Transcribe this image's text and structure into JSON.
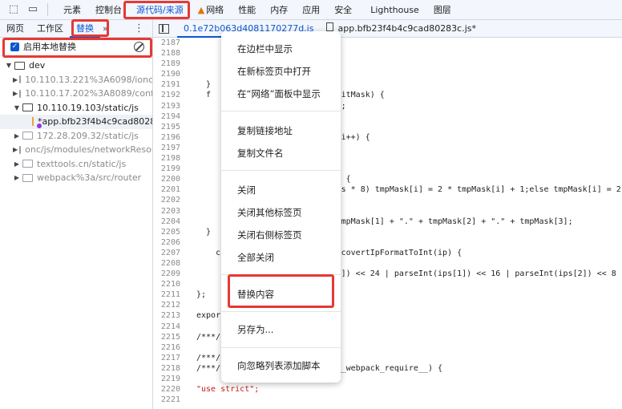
{
  "toolbar": {
    "inspect_icon": "element-picker-icon",
    "device_icon": "device-toggle-icon",
    "tabs": [
      "元素",
      "控制台",
      "源代码/来源",
      "网络",
      "性能",
      "内存",
      "应用",
      "安全",
      "Lighthouse",
      "图层"
    ],
    "active_tab": "源代码/来源",
    "network_warning_icon": "warning-icon"
  },
  "left_panel": {
    "subtabs": [
      "网页",
      "工作区",
      "替换"
    ],
    "active_subtab": "替换",
    "more_label": "»",
    "menu_icon": "kebab-menu-icon",
    "enable_overrides_label": "启用本地替换",
    "enable_overrides_checked": true,
    "tree": [
      {
        "label": "dev",
        "type": "folder",
        "expanded": true,
        "level": 0
      },
      {
        "label": "10.110.13.221%3A6098/ionc",
        "type": "folder",
        "expanded": false,
        "level": 1,
        "grey": true
      },
      {
        "label": "10.110.17.202%3A8089/config",
        "type": "folder",
        "expanded": false,
        "level": 1,
        "grey": true
      },
      {
        "label": "10.110.19.103/static/js",
        "type": "folder",
        "expanded": true,
        "level": 1
      },
      {
        "label": "*app.bfb23f4b4c9cad80283",
        "type": "file",
        "level": 2,
        "selected": true
      },
      {
        "label": "172.28.209.32/static/js",
        "type": "folder",
        "expanded": false,
        "level": 1,
        "grey": true
      },
      {
        "label": "onc/js/modules/networkResou",
        "type": "folder",
        "expanded": false,
        "level": 1,
        "grey": true
      },
      {
        "label": "texttools.cn/static/js",
        "type": "folder",
        "expanded": false,
        "level": 1,
        "grey": true
      },
      {
        "label": "webpack%3a/src/router",
        "type": "folder",
        "expanded": false,
        "level": 1,
        "grey": true
      }
    ]
  },
  "editor": {
    "tabs": [
      "0.1e72b063d4081170277d.js",
      "app.bfb23f4b4c9cad80283c.js*"
    ],
    "active_tab": "0.1e72b063d4081170277d.js",
    "lines": [
      {
        "n": "2187",
        "t": ""
      },
      {
        "n": "2188",
        "t": ""
      },
      {
        "n": "2189",
        "t": ""
      },
      {
        "n": "2190",
        "t": ""
      },
      {
        "n": "2191",
        "t": "  }"
      },
      {
        "n": "2192",
        "t": "  f                     Mask(bitMask) {"
      },
      {
        "n": "2193",
        "t": "                        urn \"\";"
      },
      {
        "n": "2194",
        "t": "                        0, 0];"
      },
      {
        "n": "2195",
        "t": "                        8;"
      },
      {
        "n": "2196",
        "t": "                        imes; i++) {"
      },
      {
        "n": "2197",
        "t": ""
      },
      {
        "n": "2198",
        "t": ""
      },
      {
        "n": "2199",
        "t": ""
      },
      {
        "n": "2200",
        "t": "                        ; j++) {"
      },
      {
        "n": "2201",
        "t": "                        - times * 8) tmpMask[i] = 2 * tmpMask[i] + 1;else tmpMask[i] = 2"
      },
      {
        "n": "2202",
        "t": ""
      },
      {
        "n": "2203",
        "t": ""
      },
      {
        "n": "2204",
        "t": "                        .\" + tmpMask[1] + \".\" + tmpMask[2] + \".\" + tmpMask[3];"
      },
      {
        "n": "2205",
        "t": "  }"
      },
      {
        "n": "2206",
        "t": ""
      },
      {
        "n": "2207",
        "t": "    c                   ction covertIpFormatToInt(ip) {"
      },
      {
        "n": "2208",
        "t": "                        ');"
      },
      {
        "n": "2209",
        "t": "                        (ips[0]) << 24 | parseInt(ips[1]) << 16 | parseInt(ips[2]) << 8"
      },
      {
        "n": "2210",
        "t": ""
      },
      {
        "n": "2211",
        "t": "};"
      },
      {
        "n": "2212",
        "t": ""
      },
      {
        "n": "2213",
        "t": "expor                   ules;"
      },
      {
        "n": "2214",
        "t": ""
      },
      {
        "n": "2215",
        "t": "/***/"
      },
      {
        "n": "2216",
        "t": ""
      },
      {
        "n": "2217",
        "t": "/***/"
      },
      {
        "n": "2218",
        "t": "/***/                   rts, __webpack_require__) {"
      },
      {
        "n": "2219",
        "t": ""
      },
      {
        "n": "2220",
        "t": "\"use strict\";",
        "str": true
      },
      {
        "n": "2221",
        "t": ""
      }
    ]
  },
  "context_menu": {
    "items": [
      "在边栏中显示",
      "在新标签页中打开",
      "在“网络”面板中显示",
      "复制链接地址",
      "复制文件名",
      "关闭",
      "关闭其他标签页",
      "关闭右侧标签页",
      "全部关闭",
      "替换内容",
      "另存为...",
      "向忽略列表添加脚本"
    ],
    "highlighted_item": "替换内容"
  },
  "highlight_color": "#e53935",
  "accent_color": "#0b57d0"
}
